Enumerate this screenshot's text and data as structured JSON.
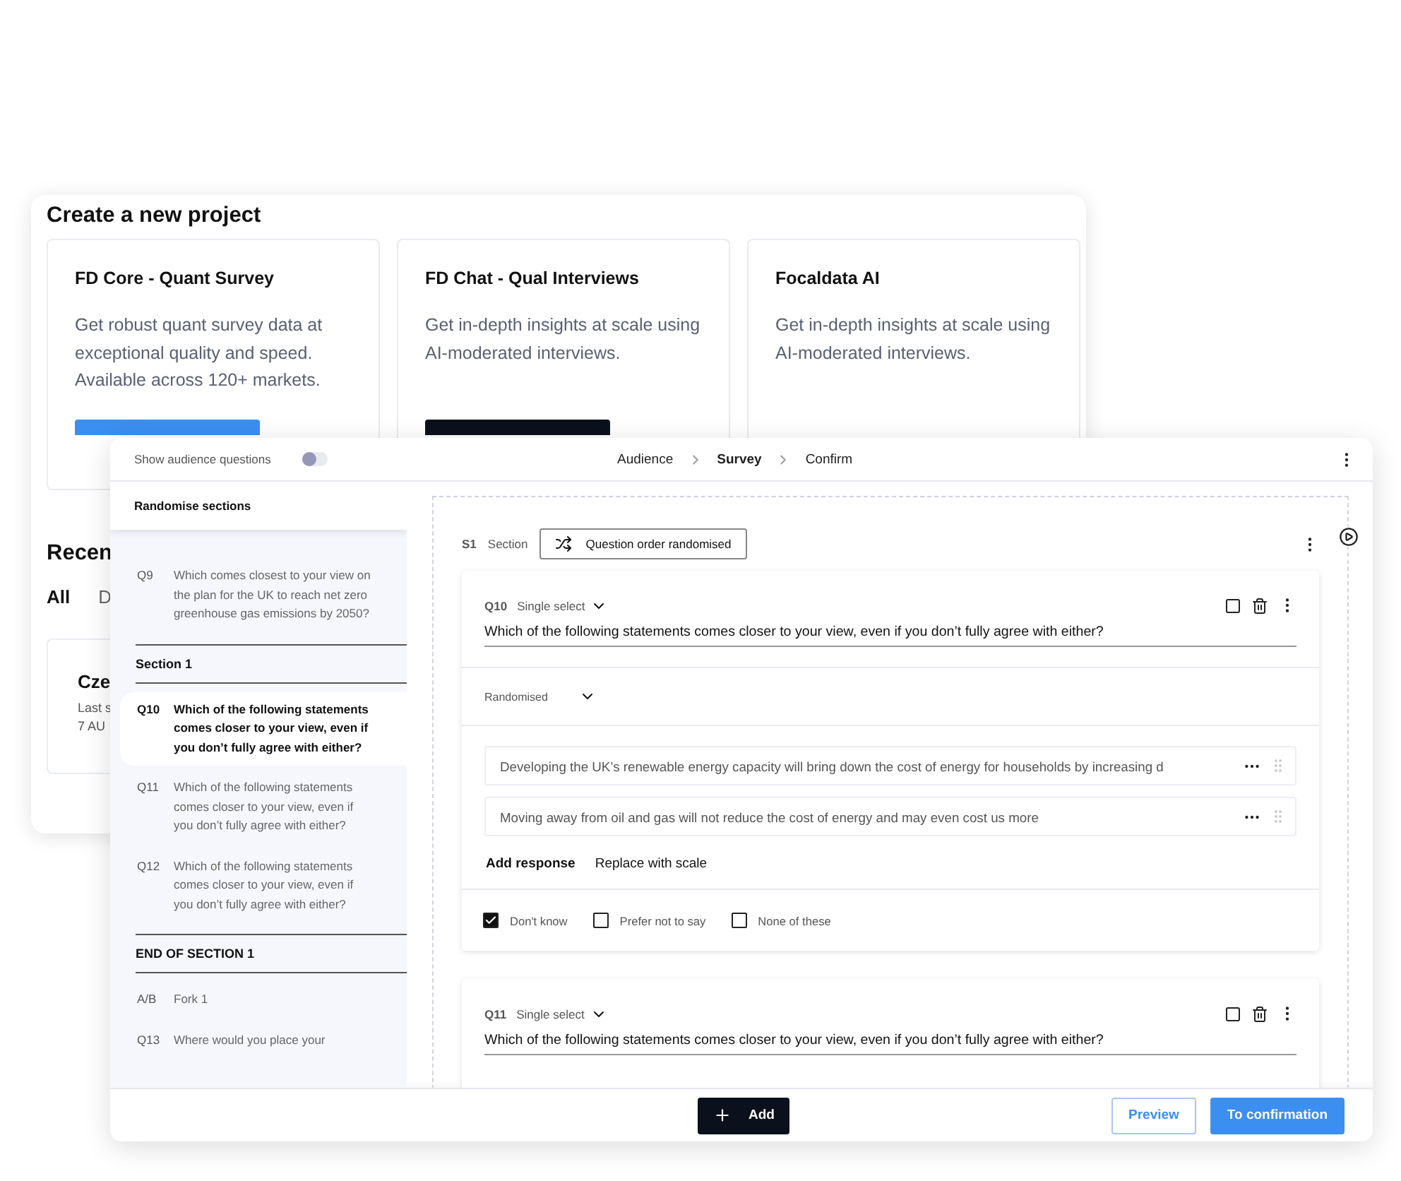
{
  "back_window": {
    "title": "Create a new project",
    "cards": [
      {
        "title": "FD Core - Quant Survey",
        "description": "Get robust quant survey data at exceptional quality and speed. Available across 120+ markets.",
        "button": {
          "kind": "primary"
        }
      },
      {
        "title": "FD Chat - Qual Interviews",
        "description": "Get in-depth insights at scale using AI-moderated interviews.",
        "button": {
          "kind": "dark"
        }
      },
      {
        "title": "Focaldata AI",
        "description": "Get in-depth insights at scale using AI-moderated interviews."
      }
    ],
    "recent": {
      "heading": "Recen",
      "tabs": [
        {
          "label": "All",
          "selected": true
        },
        {
          "label": "D",
          "selected": false
        }
      ],
      "project": {
        "name": "Cze",
        "meta": [
          "Last s",
          "7 AU"
        ]
      }
    }
  },
  "front_window": {
    "top_bar": {
      "toggle": {
        "label": "Show audience questions",
        "on": false
      },
      "breadcrumb": [
        {
          "label": "Audience",
          "selected": false
        },
        {
          "label": "Survey",
          "selected": true
        },
        {
          "label": "Confirm",
          "selected": false
        }
      ]
    },
    "sidebar": {
      "popup": "Randomise sections",
      "items": [
        {
          "kind": "question",
          "number": "Q9",
          "text": "Which comes closest to your view on the plan for the UK to reach net zero greenhouse gas emissions by 2050?",
          "selected": false
        },
        {
          "kind": "section",
          "text": "Section 1",
          "selected": false
        },
        {
          "kind": "question",
          "number": "Q10",
          "text": "Which of the following statements comes closer to your view, even if you don’t fully agree with either?",
          "selected": true
        },
        {
          "kind": "question",
          "number": "Q11",
          "text": "Which of the following statements comes closer to your view, even if you don’t fully agree with either?",
          "selected": false
        },
        {
          "kind": "question",
          "number": "Q12",
          "text": "Which of the following statements comes closer to your view, even if you don’t fully agree with either?",
          "selected": false
        },
        {
          "kind": "section",
          "text": "END OF SECTION 1",
          "selected": false
        },
        {
          "kind": "question",
          "number": "A/B",
          "text": "Fork 1",
          "selected": false
        },
        {
          "kind": "question",
          "number": "Q13",
          "text": "Where would you place your",
          "selected": false
        }
      ]
    },
    "section": {
      "number": "S1",
      "label": "Section",
      "order_button": "Question order randomised"
    },
    "questions": [
      {
        "number": "Q10",
        "type": "Single select",
        "text": "Which of the following statements comes closer to your view, even if you don’t fully agree with either?",
        "order": "Randomised",
        "responses": [
          "Developing the UK’s renewable energy capacity will bring down the cost of energy for households by increasing d",
          "Moving away from oil and gas will not reduce the cost of energy and may even cost us more"
        ],
        "actions": [
          "Add response",
          "Replace with scale"
        ],
        "options": [
          {
            "label": "Don't know",
            "checked": true
          },
          {
            "label": "Prefer not to say",
            "checked": false
          },
          {
            "label": "None of these",
            "checked": false
          }
        ]
      },
      {
        "number": "Q11",
        "type": "Single select",
        "text": "Which of the following statements comes closer to your view, even if you don’t fully agree with either?"
      }
    ],
    "bottom_bar": {
      "add": "Add",
      "buttons": [
        {
          "label": "Preview",
          "kind": "outline"
        },
        {
          "label": "To confirmation",
          "kind": "primary"
        }
      ]
    }
  }
}
